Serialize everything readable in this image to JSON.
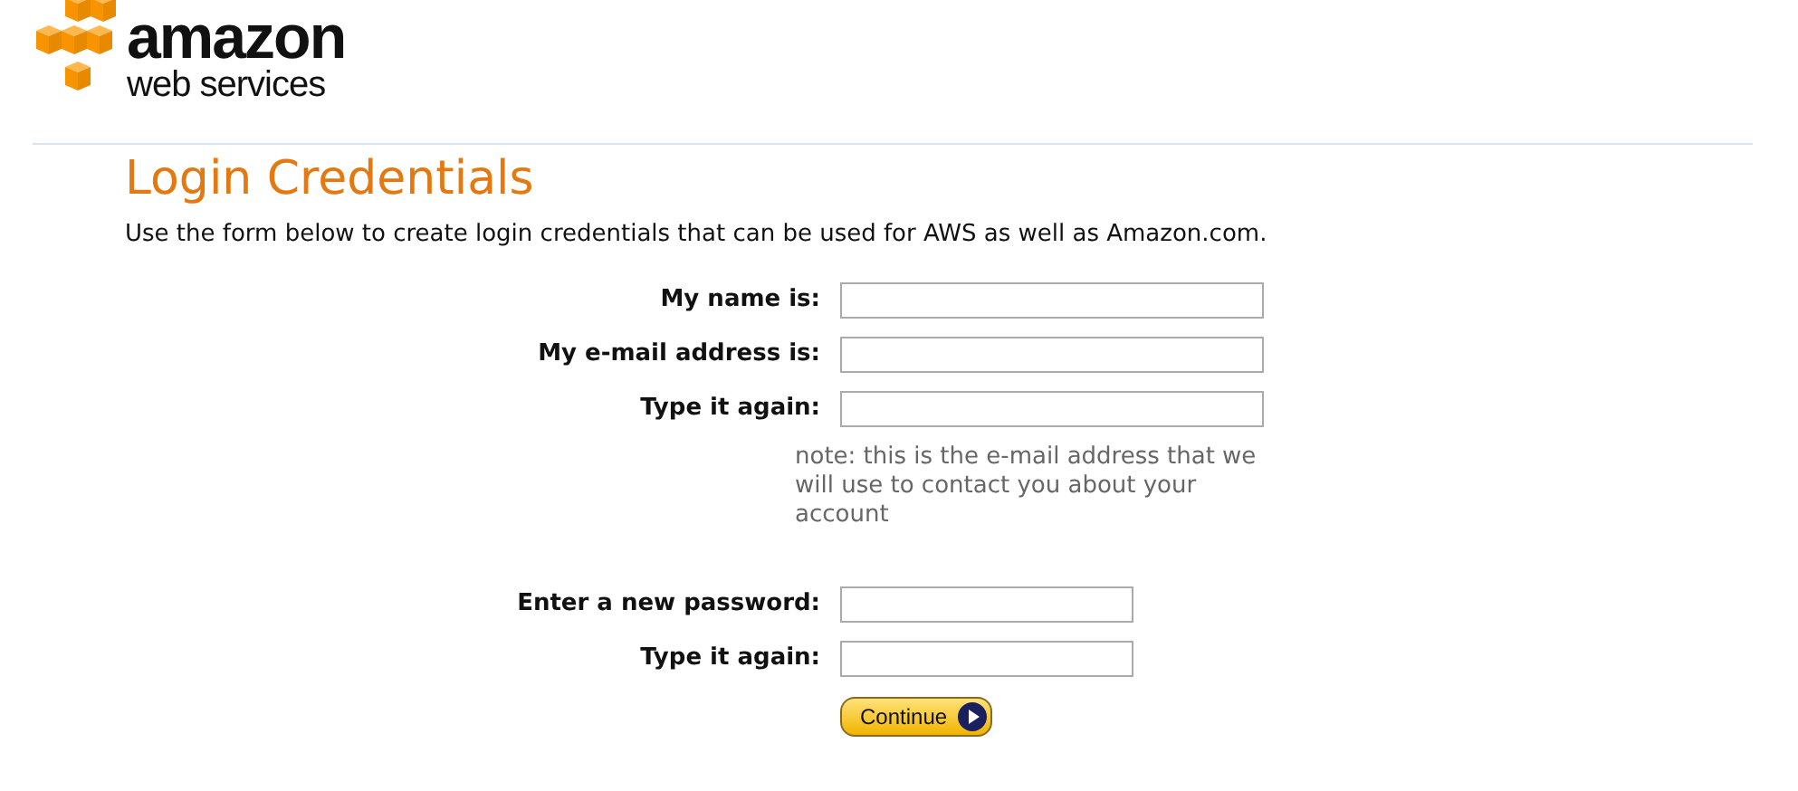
{
  "logo": {
    "brand": "amazon",
    "tagline": "web services"
  },
  "title": "Login Credentials",
  "intro": "Use the form below to create login credentials that can be used for AWS as well as Amazon.com.",
  "fields": [
    {
      "label": "My name is:",
      "kind": "text"
    },
    {
      "label": "My e-mail address is:",
      "kind": "text"
    },
    {
      "label": "Type it again:",
      "kind": "text",
      "note": "note: this is the e-mail address that we will use to contact you about your account"
    },
    {
      "label": "Enter a new password:",
      "kind": "password"
    },
    {
      "label": "Type it again:",
      "kind": "password"
    }
  ],
  "button": "Continue"
}
